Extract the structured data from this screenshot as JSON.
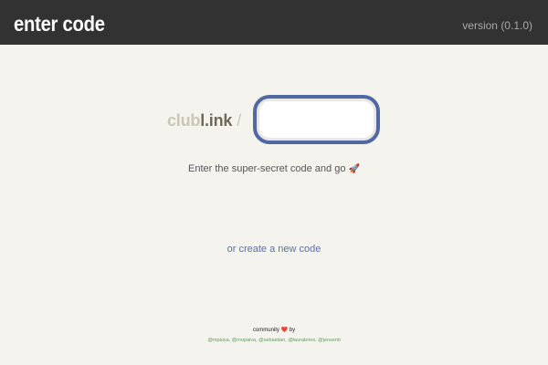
{
  "header": {
    "title": "enter code",
    "version": "version (0.1.0)"
  },
  "brand": {
    "club": "club",
    "link": "l.ink",
    "slash": "/"
  },
  "code_input": {
    "value": "",
    "placeholder": ""
  },
  "hint": {
    "text": "Enter the super-secret code and go",
    "icon": "rocket-icon"
  },
  "create_link": {
    "label": "or create a new code"
  },
  "footer": {
    "community_prefix": "community",
    "heart_icon": "heart-icon",
    "community_suffix": "by",
    "contributors": [
      "@mpaiva",
      "@mopaiva",
      "@sebastian",
      "@laurabries",
      "@jensenti"
    ]
  },
  "colors": {
    "header_bg": "#323232",
    "page_bg": "#f4f3ee",
    "input_border": "#5168a2",
    "link": "#5a6fa8",
    "contributor_link": "#5aa05a",
    "heart": "#d9443f"
  }
}
